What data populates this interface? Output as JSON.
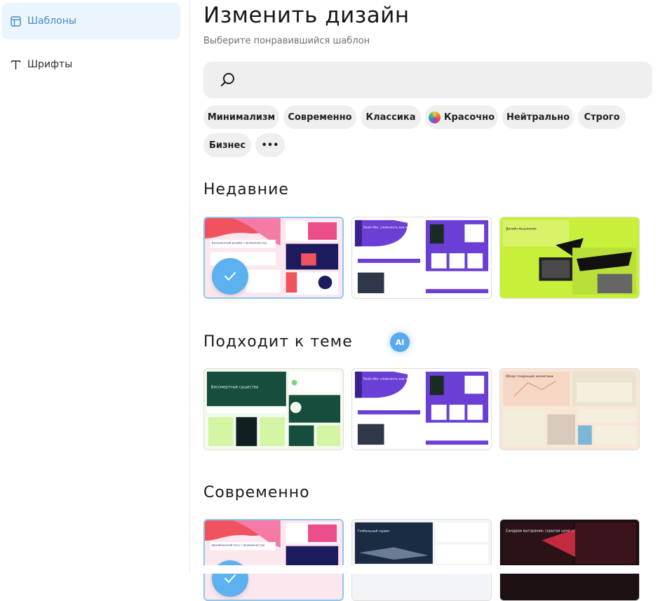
{
  "sidebar": {
    "items": [
      {
        "label": "Шаблоны",
        "icon": "layout-icon",
        "active": true
      },
      {
        "label": "Шрифты",
        "icon": "text-type-icon",
        "active": false
      }
    ]
  },
  "header": {
    "title": "Изменить дизайн",
    "subtitle": "Выберите понравившийся шаблон"
  },
  "search": {
    "icon": "search-icon",
    "value": "",
    "placeholder": ""
  },
  "chips": [
    {
      "label": "Минимализм"
    },
    {
      "label": "Современно"
    },
    {
      "label": "Классика"
    },
    {
      "label": "Красочно",
      "icon": "color-ball-icon"
    },
    {
      "label": "Нейтрально"
    },
    {
      "label": "Строго"
    },
    {
      "label": "Бизнес"
    },
    {
      "label": "•••",
      "icon": "more-dots-icon"
    }
  ],
  "sections": [
    {
      "title": "Недавние",
      "templates": [
        {
          "selected": true,
          "text": "Бесконечный дизайн с возможностью"
        },
        {
          "selected": false,
          "text": "Souls-like: сложность как искусство"
        },
        {
          "selected": false,
          "text": "Дизайн-мышление"
        }
      ]
    },
    {
      "title": "Подходит к теме",
      "badge": "AI",
      "templates": [
        {
          "selected": false,
          "text": "Бессмертные существа"
        },
        {
          "selected": false,
          "text": "Souls-like: сложность как искусство"
        },
        {
          "selected": false,
          "text": "Обзор тенденций косметики"
        }
      ]
    },
    {
      "title": "Современно",
      "templates": [
        {
          "selected": true,
          "text": "Дизайнерский путь с возможностью"
        },
        {
          "selected": false,
          "text": "Глобальный сервис"
        },
        {
          "selected": false,
          "text": "Синдром выгорания: скрытая цена для людей и бизнеса"
        }
      ]
    }
  ],
  "colors": {
    "accent": "#5aa9ec",
    "active_bg": "#eaf5fd",
    "active_text": "#4a8bbd",
    "chip_bg": "#efefef"
  }
}
